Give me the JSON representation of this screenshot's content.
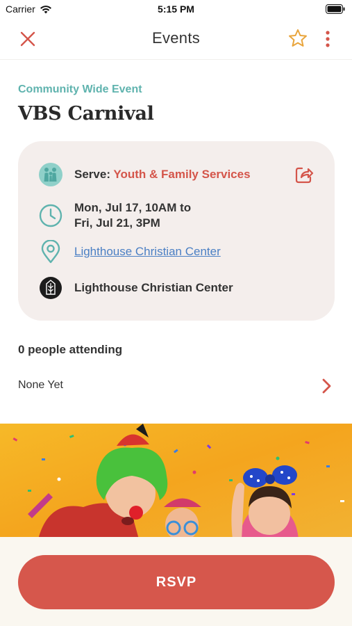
{
  "status_bar": {
    "carrier": "Carrier",
    "time": "5:15 PM",
    "icons": [
      "wifi-icon",
      "battery-icon"
    ]
  },
  "nav": {
    "title": "Events",
    "close_icon": "close-icon",
    "favorite_icon": "star-icon",
    "more_icon": "more-vertical-icon"
  },
  "event": {
    "type": "Community Wide Event",
    "title": "VBS Carnival"
  },
  "details": {
    "serve_label": "Serve:",
    "serve_org": "Youth & Family Services",
    "date_line1": "Mon, Jul 17, 10AM to",
    "date_line2": "Fri, Jul 21, 3PM",
    "location": "Lighthouse Christian Center",
    "host": "Lighthouse Christian Center",
    "icons": [
      "family-icon",
      "clock-icon",
      "location-pin-icon",
      "church-logo-icon",
      "share-icon"
    ]
  },
  "attending": {
    "count_text": "0 people attending",
    "attendees_text": "None Yet"
  },
  "footer": {
    "rsvp_label": "RSVP"
  },
  "colors": {
    "accent_red": "#d6574c",
    "accent_teal": "#5fb3ae",
    "link_blue": "#4a7fc4",
    "card_bg": "#f4eeec",
    "footer_bg": "#faf7f0"
  }
}
